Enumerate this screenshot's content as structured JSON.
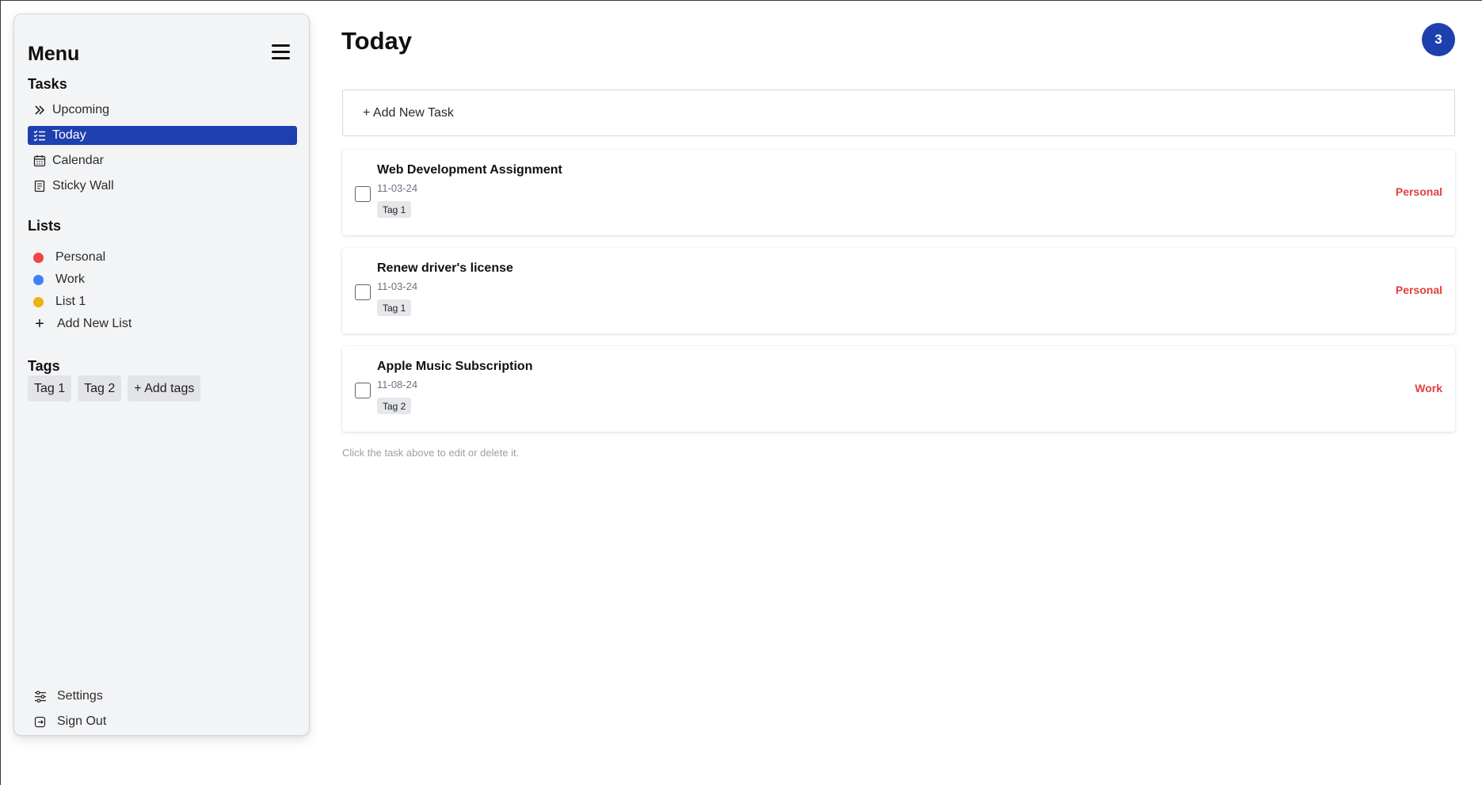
{
  "sidebar": {
    "title": "Menu",
    "tasks_heading": "Tasks",
    "task_nav": [
      {
        "label": "Upcoming",
        "icon": "double-chevron-right-icon"
      },
      {
        "label": "Today",
        "icon": "checklist-icon",
        "active": true
      },
      {
        "label": "Calendar",
        "icon": "calendar-icon"
      },
      {
        "label": "Sticky Wall",
        "icon": "note-icon"
      }
    ],
    "lists_heading": "Lists",
    "lists": [
      {
        "label": "Personal",
        "color": "#ef4444"
      },
      {
        "label": "Work",
        "color": "#3b82f6"
      },
      {
        "label": "List 1",
        "color": "#eab308"
      }
    ],
    "add_list_label": "Add New List",
    "tags_heading": "Tags",
    "tags": [
      "Tag 1",
      "Tag 2"
    ],
    "add_tags_label": "+ Add tags",
    "settings_label": "Settings",
    "signout_label": "Sign Out"
  },
  "main": {
    "title": "Today",
    "count": "3",
    "add_task_label": "+ Add New Task",
    "tasks": [
      {
        "title": "Web Development Assignment",
        "date": "11-03-24",
        "tag": "Tag 1",
        "list": "Personal",
        "checked": false
      },
      {
        "title": "Renew driver's license",
        "date": "11-03-24",
        "tag": "Tag 1",
        "list": "Personal",
        "checked": false
      },
      {
        "title": "Apple Music Subscription",
        "date": "11-08-24",
        "tag": "Tag 2",
        "list": "Work",
        "checked": false
      }
    ],
    "hint": "Click the task above to edit or delete it."
  },
  "colors": {
    "accent": "#1e40af",
    "list_label": "#e53e3e",
    "sidebar_bg": "#f3f4f6"
  }
}
